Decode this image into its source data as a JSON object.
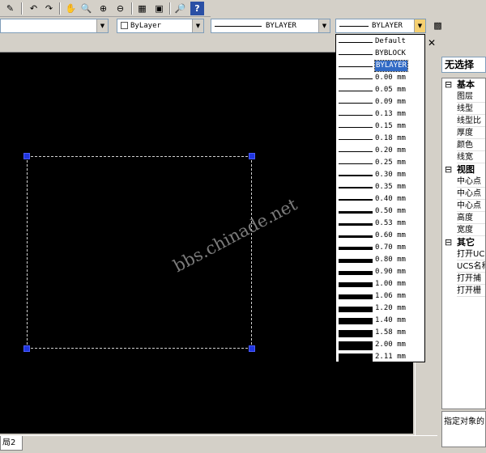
{
  "toolbar": {
    "icons": [
      "pencil-icon",
      "undo-icon",
      "redo-icon",
      "pan-icon",
      "zoom-realtime-icon",
      "zoom-window-icon",
      "zoom-previous-icon",
      "properties-icon",
      "design-center-icon",
      "tool-palettes-icon",
      "help-icon"
    ]
  },
  "properties_bar": {
    "color_value": "ByLayer",
    "linetype_value": "BYLAYER",
    "lineweight_value": "BYLAYER"
  },
  "lineweight_dropdown": {
    "selected": "BYLAYER",
    "items": [
      {
        "label": "Default",
        "weight": 1
      },
      {
        "label": "BYBLOCK",
        "weight": 1
      },
      {
        "label": "BYLAYER",
        "weight": 1
      },
      {
        "label": "0.00 mm",
        "weight": 1
      },
      {
        "label": "0.05 mm",
        "weight": 1
      },
      {
        "label": "0.09 mm",
        "weight": 1
      },
      {
        "label": "0.13 mm",
        "weight": 1
      },
      {
        "label": "0.15 mm",
        "weight": 1
      },
      {
        "label": "0.18 mm",
        "weight": 1
      },
      {
        "label": "0.20 mm",
        "weight": 1
      },
      {
        "label": "0.25 mm",
        "weight": 1
      },
      {
        "label": "0.30 mm",
        "weight": 2
      },
      {
        "label": "0.35 mm",
        "weight": 2
      },
      {
        "label": "0.40 mm",
        "weight": 2
      },
      {
        "label": "0.50 mm",
        "weight": 3
      },
      {
        "label": "0.53 mm",
        "weight": 3
      },
      {
        "label": "0.60 mm",
        "weight": 3
      },
      {
        "label": "0.70 mm",
        "weight": 4
      },
      {
        "label": "0.80 mm",
        "weight": 5
      },
      {
        "label": "0.90 mm",
        "weight": 5
      },
      {
        "label": "1.00 mm",
        "weight": 6
      },
      {
        "label": "1.06 mm",
        "weight": 6
      },
      {
        "label": "1.20 mm",
        "weight": 7
      },
      {
        "label": "1.40 mm",
        "weight": 8
      },
      {
        "label": "1.58 mm",
        "weight": 9
      },
      {
        "label": "2.00 mm",
        "weight": 11
      },
      {
        "label": "2.11 mm",
        "weight": 11
      }
    ]
  },
  "canvas": {
    "watermark": "bbs.chinade.net",
    "background": "#000000",
    "grip_color": "#2036e0"
  },
  "properties_panel": {
    "selection": "无选择",
    "sections": [
      {
        "title": "基本",
        "items": [
          "图层",
          "线型",
          "线型比",
          "厚度",
          "颜色",
          "线宽"
        ]
      },
      {
        "title": "视图",
        "items": [
          "中心点",
          "中心点",
          "中心点",
          "高度",
          "宽度"
        ]
      },
      {
        "title": "其它",
        "items": [
          "打开UC",
          "UCS名称",
          "打开捕",
          "打开栅"
        ]
      }
    ],
    "description": "指定对象的"
  },
  "tabs": {
    "layout_tab": "局2"
  }
}
